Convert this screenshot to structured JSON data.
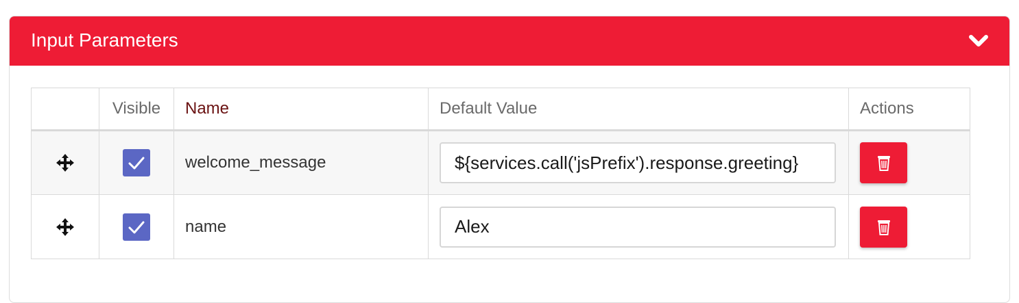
{
  "panel": {
    "title": "Input Parameters",
    "collapse_icon": "chevron-down-icon",
    "accent_color": "#ee1c35"
  },
  "table": {
    "headers": {
      "drag": "",
      "visible": "Visible",
      "name": "Name",
      "default_value": "Default Value",
      "actions": "Actions"
    },
    "rows": [
      {
        "visible": true,
        "name": "welcome_message",
        "default_value": "${services.call('jsPrefix').response.greeting}",
        "drag_icon": "move-arrows-icon",
        "delete_icon": "trash-icon"
      },
      {
        "visible": true,
        "name": "name",
        "default_value": "Alex",
        "drag_icon": "move-arrows-icon",
        "delete_icon": "trash-icon"
      }
    ]
  },
  "colors": {
    "checkbox": "#5b67c4",
    "delete_button": "#ee1c35",
    "name_header": "#6b1313"
  }
}
